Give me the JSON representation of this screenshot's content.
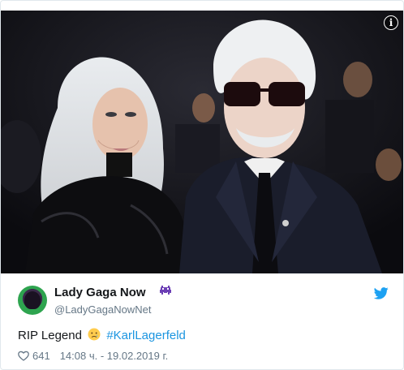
{
  "photo": {
    "info_icon_glyph": "i",
    "background_color": "#0e0f14"
  },
  "author": {
    "display_name": "Lady Gaga Now",
    "handle": "@LadyGagaNowNet",
    "badge_icon": "alien-monster-icon",
    "avatar_icon": "profile-avatar"
  },
  "tweet": {
    "text": "RIP Legend",
    "emoji": "crying-face",
    "hashtag": "#KarlLagerfeld"
  },
  "meta": {
    "likes": "641",
    "timestamp": "14:08 ч. - 19.02.2019 г."
  },
  "colors": {
    "accent": "#1b95e0",
    "secondary_text": "#657786",
    "primary_text": "#14171a",
    "twitter_blue": "#1da1f2"
  }
}
